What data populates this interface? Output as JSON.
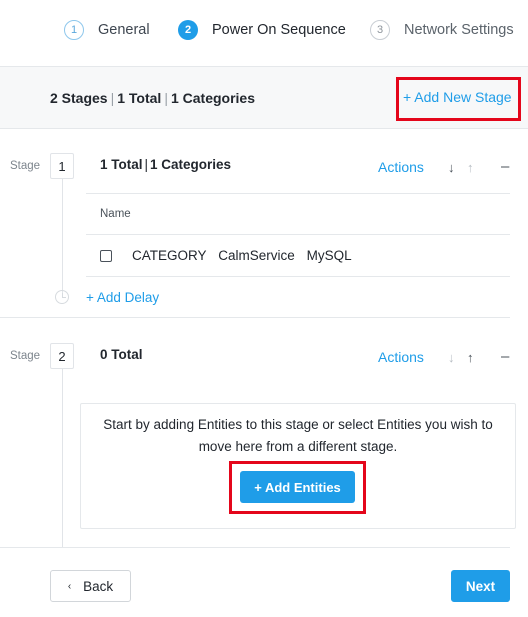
{
  "stepper": {
    "steps": [
      {
        "number": "1",
        "label": "General",
        "state": "done"
      },
      {
        "number": "2",
        "label": "Power On Sequence",
        "state": "active"
      },
      {
        "number": "3",
        "label": "Network Settings",
        "state": "pending"
      }
    ]
  },
  "summary": {
    "stages": "2 Stages",
    "total": "1 Total",
    "categories": "1 Categories",
    "add_stage": "+ Add New Stage"
  },
  "stages": [
    {
      "tag": "Stage",
      "number": "1",
      "total": "1 Total",
      "categories": "1 Categories",
      "actions": "Actions",
      "up_arrow": "↑",
      "down_arrow": "↓",
      "collapse": "–",
      "column_header": "Name",
      "entity": {
        "type": "CATEGORY",
        "key": "CalmService",
        "value": "MySQL"
      },
      "add_delay": "+ Add Delay"
    },
    {
      "tag": "Stage",
      "number": "2",
      "total": "0 Total",
      "actions": "Actions",
      "up_arrow": "↑",
      "down_arrow": "↓",
      "collapse": "–",
      "empty_message": "Start by adding Entities to this stage or select Entities you wish to move here from a different stage.",
      "add_entities": "+ Add Entities"
    }
  ],
  "footer": {
    "back_icon": "‹",
    "back": "Back",
    "next": "Next"
  },
  "colors": {
    "accent": "#1f9de8",
    "highlight": "#e4061b"
  }
}
